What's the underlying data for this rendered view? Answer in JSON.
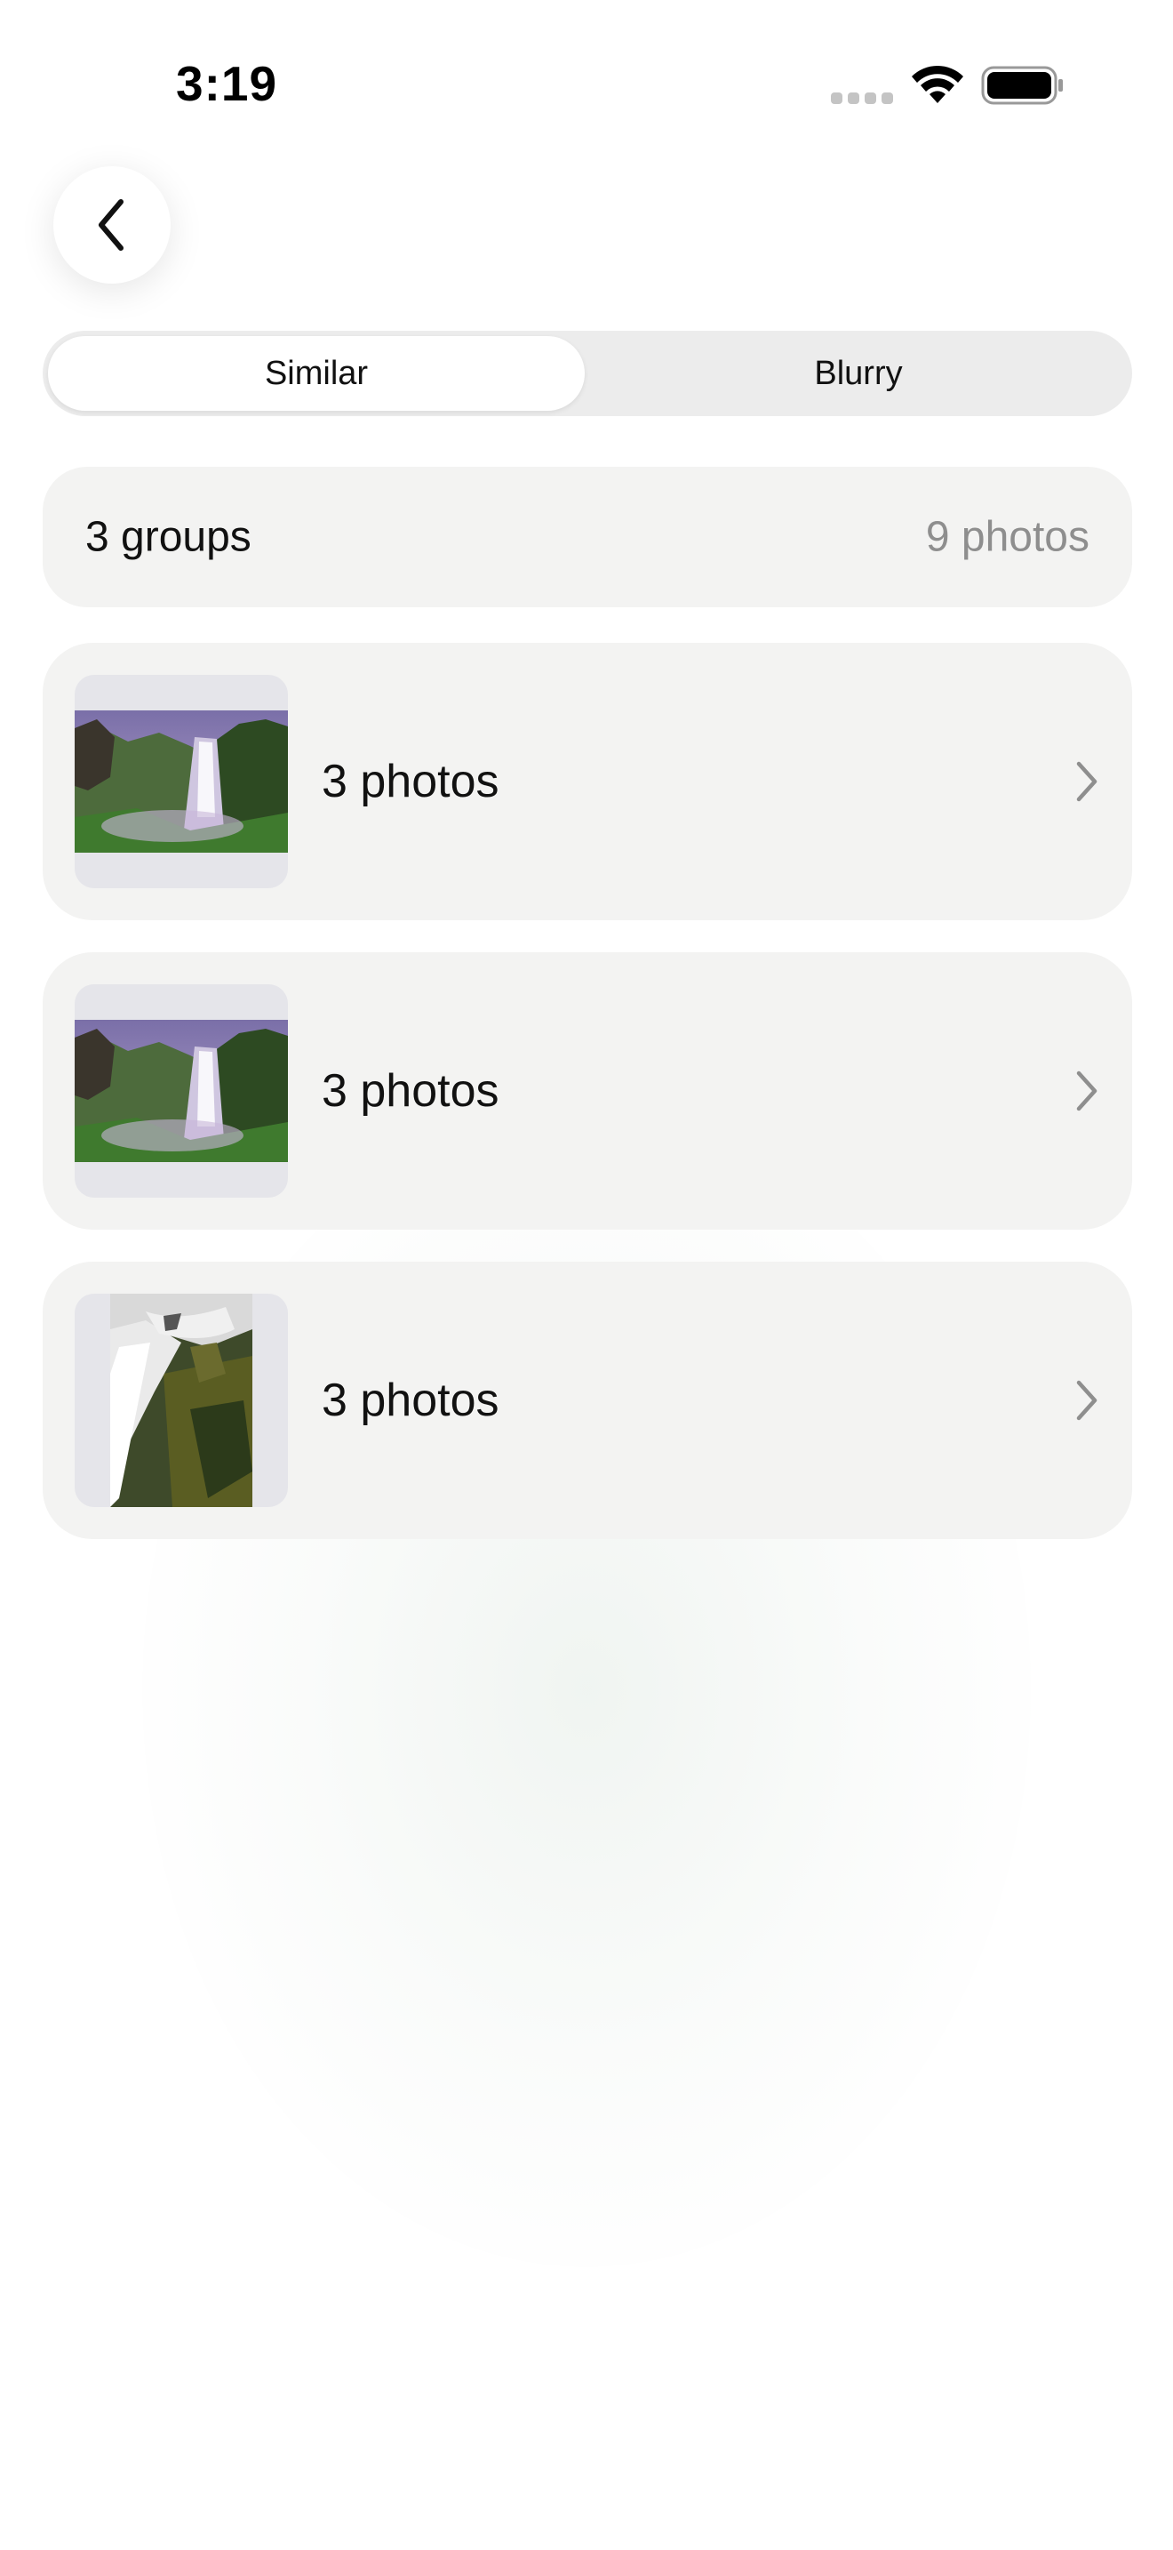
{
  "status_bar": {
    "time": "3:19",
    "icons": [
      "cellular-signal-icon",
      "wifi-icon",
      "battery-icon"
    ]
  },
  "navigation": {
    "back_icon": "chevron-left-icon"
  },
  "segmented_control": {
    "selected": "Similar",
    "options": [
      "Similar",
      "Blurry"
    ]
  },
  "summary": {
    "groups_label": "3 groups",
    "photos_label": "9 photos"
  },
  "groups": [
    {
      "count_label": "3 photos",
      "thumbnail": "waterfall-landscape"
    },
    {
      "count_label": "3 photos",
      "thumbnail": "waterfall-landscape"
    },
    {
      "count_label": "3 photos",
      "thumbnail": "waterfall-portrait"
    }
  ],
  "colors": {
    "card_background": "#f3f3f2",
    "segment_background": "#ececec",
    "secondary_text": "#8e8e8e",
    "chevron": "#8e8e8e"
  }
}
